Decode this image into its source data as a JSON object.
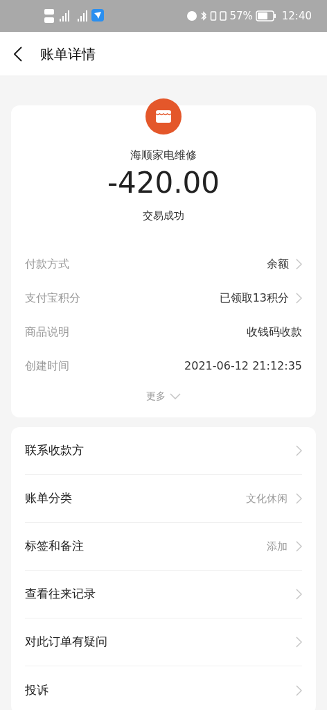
{
  "status_bar": {
    "battery": "57%",
    "time": "12:40"
  },
  "header": {
    "title": "账单详情"
  },
  "summary": {
    "merchant": "海顺家电维修",
    "amount": "-420.00",
    "status": "交易成功"
  },
  "details": [
    {
      "label": "付款方式",
      "value": "余额",
      "kind": "link"
    },
    {
      "label": "支付宝积分",
      "value": "已领取13积分",
      "kind": "link"
    },
    {
      "label": "商品说明",
      "value": "收钱码收款",
      "kind": "plain"
    },
    {
      "label": "创建时间",
      "value": "2021-06-12 21:12:35",
      "kind": "plain"
    }
  ],
  "more": {
    "label": "更多",
    "expanded": false
  },
  "menu": [
    {
      "label": "联系收款方"
    },
    {
      "label": "账单分类",
      "value": "文化休闲"
    },
    {
      "label": "标签和备注",
      "value": "添加"
    },
    {
      "label": "查看往来记录"
    },
    {
      "label": "对此订单有疑问"
    },
    {
      "label": "投诉"
    }
  ]
}
